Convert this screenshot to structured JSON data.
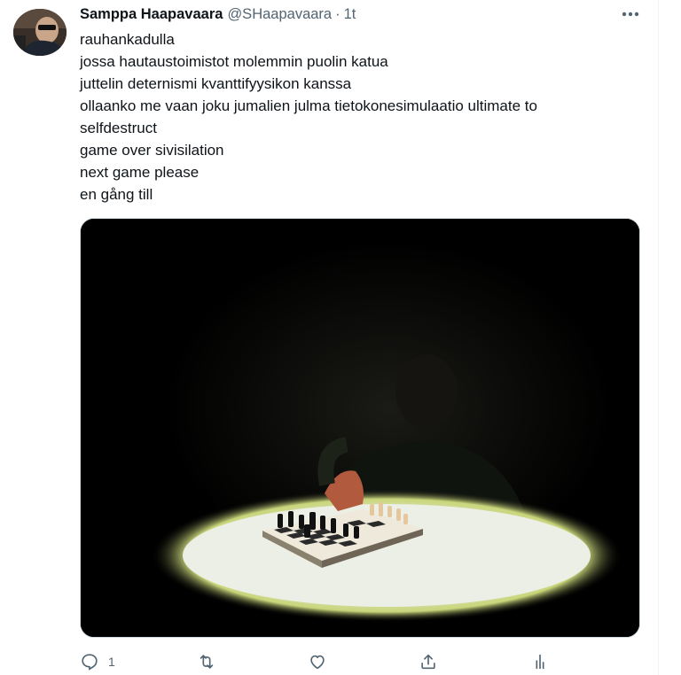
{
  "tweet": {
    "author_name": "Samppa Haapavaara",
    "author_handle": "@SHaapavaara",
    "separator": "·",
    "time": "1t",
    "text_lines": [
      "rauhankadulla",
      "jossa hautaustoimistot molemmin puolin katua",
      "juttelin deternismi kvanttifyysikon kanssa",
      "ollaanko me vaan joku jumalien julma tietokonesimulaatio ultimate to",
      "selfdestruct",
      "game over sivisilation",
      "next game please",
      "en gång till"
    ],
    "media": {
      "description": "",
      "icon": "photo"
    }
  },
  "actions": {
    "reply": {
      "icon": "reply-icon",
      "count": "1"
    },
    "retweet": {
      "icon": "retweet-icon",
      "count": ""
    },
    "like": {
      "icon": "heart-icon",
      "count": ""
    },
    "share": {
      "icon": "share-icon"
    },
    "analytics": {
      "icon": "analytics-icon"
    }
  },
  "colors": {
    "text": "#0f1419",
    "secondary": "#536471",
    "border": "#cfd9de"
  }
}
